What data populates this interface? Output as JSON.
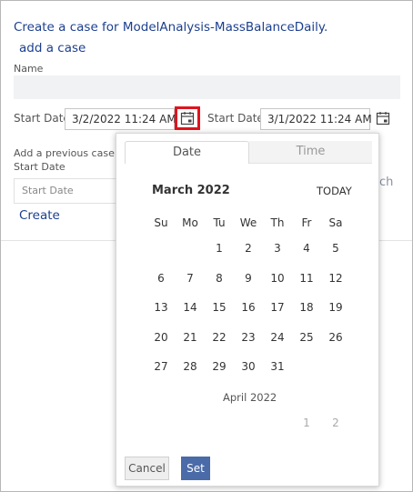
{
  "header": {
    "title": "Create a case for ModelAnalysis-MassBalanceDaily.",
    "add_case": "add a case"
  },
  "form": {
    "name_label": "Name",
    "start_date_label_1": "Start Date",
    "start_date_value_1": "3/2/2022 11:24 AM",
    "start_date_label_2": "Start Date",
    "start_date_value_2": "3/1/2022 11:24 AM",
    "previous_case_label_1": "Add a previous case",
    "previous_case_label_2": "Start Date",
    "previous_case_placeholder": "Start Date",
    "create_link": "Create",
    "ghost_text": "ch"
  },
  "calendar": {
    "tabs": [
      "Date",
      "Time"
    ],
    "month_label": "March 2022",
    "today_label": "TODAY",
    "weekdays": [
      "Su",
      "Mo",
      "Tu",
      "We",
      "Th",
      "Fr",
      "Sa"
    ],
    "weeks": [
      [
        "",
        "",
        "1",
        "2",
        "3",
        "4",
        "5"
      ],
      [
        "6",
        "7",
        "8",
        "9",
        "10",
        "11",
        "12"
      ],
      [
        "13",
        "14",
        "15",
        "16",
        "17",
        "18",
        "19"
      ],
      [
        "20",
        "21",
        "22",
        "23",
        "24",
        "25",
        "26"
      ],
      [
        "27",
        "28",
        "29",
        "30",
        "31",
        "",
        ""
      ]
    ],
    "next_month_label": "April 2022",
    "next_month_week": [
      "",
      "",
      "",
      "",
      "",
      "1",
      "2"
    ],
    "cancel_label": "Cancel",
    "set_label": "Set"
  },
  "colors": {
    "link": "#1c3f8f",
    "highlight": "#e0141e",
    "set_button": "#4a6aa8"
  },
  "icons": {
    "calendar_button": "calendar-icon"
  }
}
